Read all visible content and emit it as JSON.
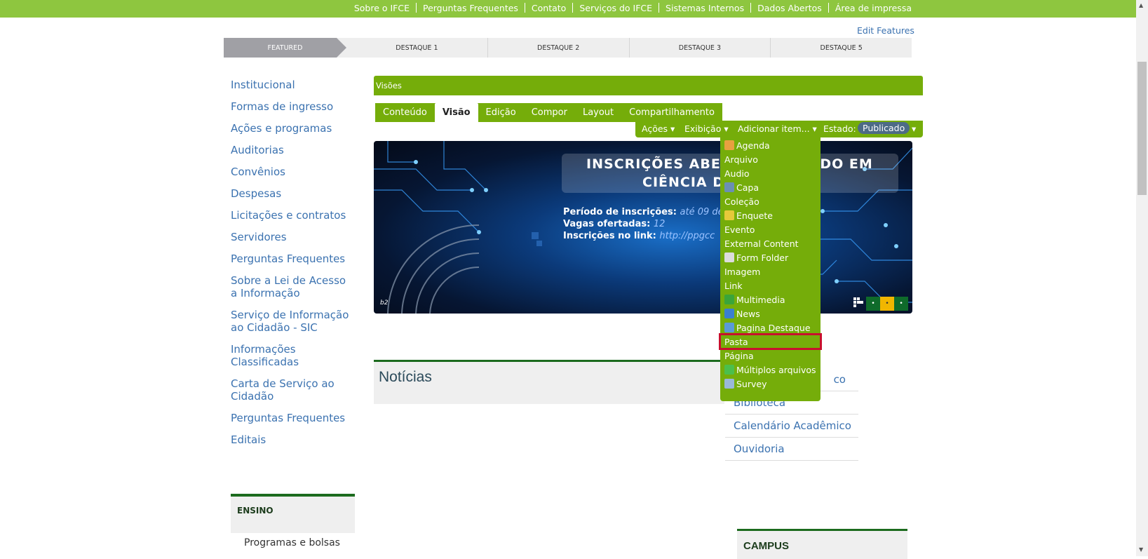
{
  "top_links": [
    "Sobre o IFCE",
    "Perguntas Frequentes",
    "Contato",
    "Serviços do IFCE",
    "Sistemas Internos",
    "Dados Abertos",
    "Área de impressa"
  ],
  "edit_features": "Edit Features",
  "featured_tabs": [
    "FEATURED",
    "DESTAQUE 1",
    "DESTAQUE 2",
    "DESTAQUE 3",
    "DESTAQUE 5"
  ],
  "left_nav": [
    "Institucional",
    "Formas de ingresso",
    "Ações e programas",
    "Auditorias",
    "Convênios",
    "Despesas",
    "Licitações e contratos",
    "Servidores",
    "Perguntas Frequentes",
    "Sobre a Lei de Acesso a Informação",
    "Serviço de Informação ao Cidadão - SIC",
    "Informações Classificadas",
    "Carta de Serviço ao Cidadão",
    "Perguntas Frequentes",
    "Editais"
  ],
  "ensino": {
    "title": "ENSINO",
    "first_item": "Programas e bolsas"
  },
  "visoes": "Visões",
  "edit_tabs": [
    "Conteúdo",
    "Visão",
    "Edição",
    "Compor",
    "Layout",
    "Compartilhamento"
  ],
  "action_bar": {
    "acoes": "Ações ▾",
    "exibicao": "Exibição ▾",
    "adicionar": "Adicionar item... ▾",
    "estado_label": "Estado:",
    "estado_value": "Publicado",
    "estado_arrow": "▾"
  },
  "banner": {
    "title_line1": "INSCRIÇÕES ABERT",
    "title_line1_end": "RADO EM",
    "title_line2": "CIÊNCIA DA",
    "periodo_label": "Período de inscrições:",
    "periodo_value": "até 09 de",
    "vagas_label": "Vagas ofertadas:",
    "vagas_value": "12",
    "link_label": "Inscrições no link:",
    "link_value": "http://ppgcc",
    "corner_label": "b2",
    "dots": [
      "•",
      "•",
      "•"
    ]
  },
  "noticias": "Notícias",
  "right_links": [
    "co",
    "Biblioteca",
    "Calendário Acadêmico",
    "Ouvidoria"
  ],
  "campus": "CAMPUS",
  "add_item_menu": [
    {
      "label": "Agenda",
      "icon": "calendar-icon",
      "color": "#e8a040"
    },
    {
      "label": "Arquivo",
      "icon": "",
      "color": ""
    },
    {
      "label": "Audio",
      "icon": "",
      "color": ""
    },
    {
      "label": "Capa",
      "icon": "cover-icon",
      "color": "#6b8fb3"
    },
    {
      "label": "Coleção",
      "icon": "",
      "color": ""
    },
    {
      "label": "Enquete",
      "icon": "poll-icon",
      "color": "#e5c93a"
    },
    {
      "label": "Evento",
      "icon": "",
      "color": ""
    },
    {
      "label": "External Content",
      "icon": "",
      "color": ""
    },
    {
      "label": "Form Folder",
      "icon": "form-folder-icon",
      "color": "#dcdcdc"
    },
    {
      "label": "Imagem",
      "icon": "",
      "color": ""
    },
    {
      "label": "Link",
      "icon": "",
      "color": ""
    },
    {
      "label": "Multimedia",
      "icon": "multimedia-icon",
      "color": "#3aa53a"
    },
    {
      "label": "News",
      "icon": "news-icon",
      "color": "#3a7fd0"
    },
    {
      "label": "Pagina Destaque",
      "icon": "featured-page-icon",
      "color": "#5a9ad8"
    },
    {
      "label": "Pasta",
      "icon": "",
      "color": "",
      "highlighted": true
    },
    {
      "label": "Página",
      "icon": "",
      "color": ""
    },
    {
      "label": "Múltiplos arquivos",
      "icon": "multiple-files-icon",
      "color": "#4cbf4c"
    },
    {
      "label": "Survey",
      "icon": "survey-icon",
      "color": "#9ab8d8"
    }
  ]
}
